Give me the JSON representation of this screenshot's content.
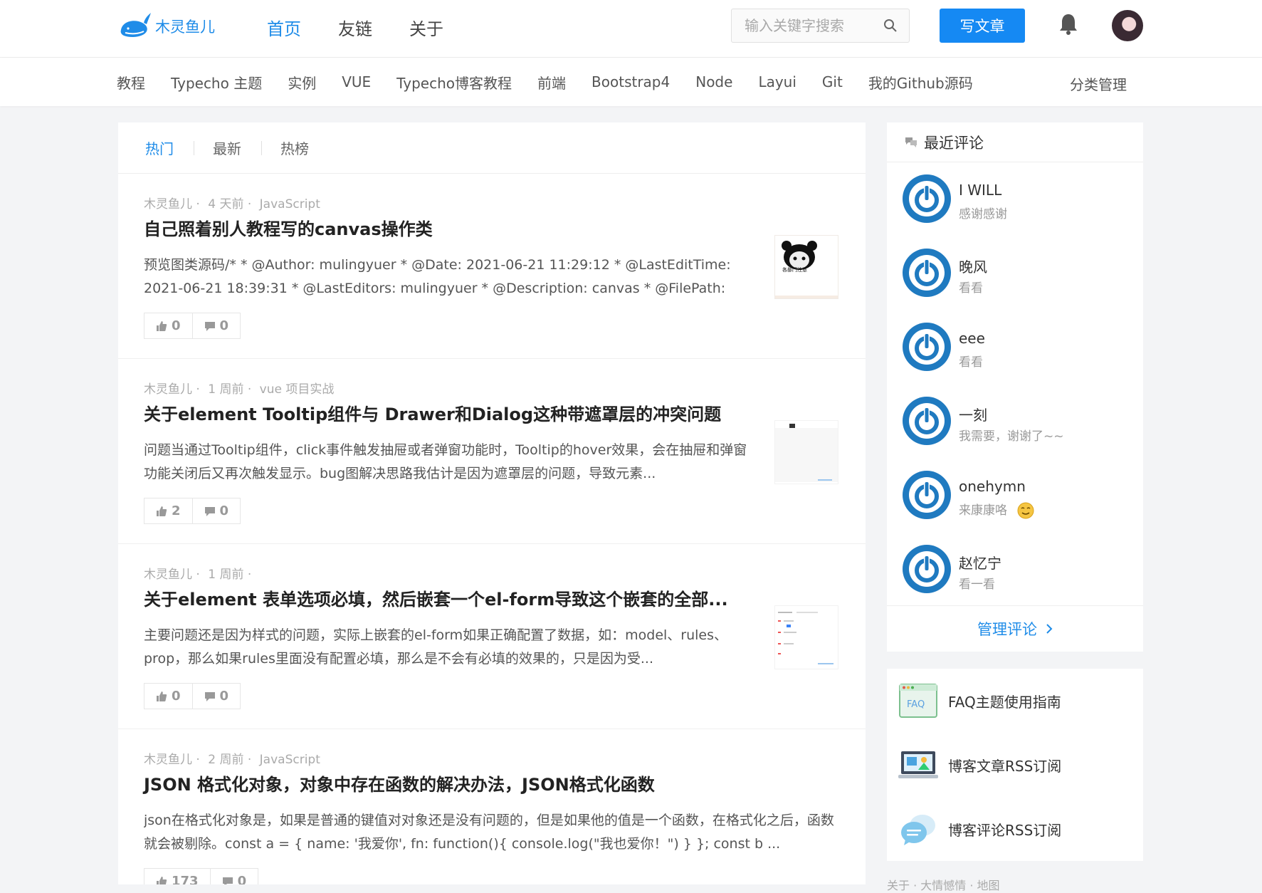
{
  "header": {
    "logo_text": "木灵鱼儿",
    "nav": [
      {
        "label": "首页",
        "active": true
      },
      {
        "label": "友链",
        "active": false
      },
      {
        "label": "关于",
        "active": false
      }
    ],
    "search_placeholder": "输入关键字搜索",
    "write_button": "写文章"
  },
  "categories": [
    "教程",
    "Typecho 主题",
    "实例",
    "VUE",
    "Typecho博客教程",
    "前端",
    "Bootstrap4",
    "Node",
    "Layui",
    "Git",
    "我的Github源码"
  ],
  "category_manage": "分类管理",
  "tabs": [
    {
      "label": "热门",
      "active": true
    },
    {
      "label": "最新",
      "active": false
    },
    {
      "label": "热榜",
      "active": false
    }
  ],
  "posts": [
    {
      "author": "木灵鱼儿 ·",
      "time": "4 天前 ·",
      "category": "JavaScript",
      "title": "自己照着别人教程写的canvas操作类",
      "excerpt": "预览图类源码/* * @Author: mulingyuer * @Date: 2021-06-21 11:29:12 * @LastEditTime: 2021-06-21 18:39:31 * @LastEditors: mulingyuer * @Description: canvas * @FilePath: \\for...",
      "likes": "0",
      "comments": "0",
      "thumb_text": "各部门注意"
    },
    {
      "author": "木灵鱼儿 ·",
      "time": "1 周前 ·",
      "category": "vue 项目实战",
      "title": "关于element Tooltip组件与 Drawer和Dialog这种带遮罩层的冲突问题",
      "excerpt": "问题当通过Tooltip组件，click事件触发抽屉或者弹窗功能时，Tooltip的hover效果，会在抽屉和弹窗功能关闭后又再次触发显示。bug图解决思路我估计是因为遮罩层的问题，导致元素...",
      "likes": "2",
      "comments": "0",
      "thumb_text": ""
    },
    {
      "author": "木灵鱼儿 ·",
      "time": "1 周前 ·",
      "category": "",
      "title": "关于element 表单选项必填，然后嵌套一个el-form导致这个嵌套的全部...",
      "excerpt": "主要问题还是因为样式的问题，实际上嵌套的el-form如果正确配置了数据，如：model、rules、prop，那么如果rules里面没有配置必填，那么是不会有必填的效果的，只是因为受...",
      "likes": "0",
      "comments": "0",
      "thumb_text": ""
    },
    {
      "author": "木灵鱼儿 ·",
      "time": "2 周前 ·",
      "category": "JavaScript",
      "title": "JSON 格式化对象，对象中存在函数的解决办法，JSON格式化函数",
      "excerpt": "json在格式化对象是，如果是普通的键值对对象还是没有问题的，但是如果他的值是一个函数，在格式化之后，函数就会被剔除。const a = { name: '我爱你', fn: function(){ console.log(\"我也爱你！\") } }; const b ...",
      "likes": "173",
      "comments": "0",
      "thumb_text": ""
    }
  ],
  "sidebar": {
    "recent_title": "最近评论",
    "comments": [
      {
        "name": "I WILL",
        "text": "感谢感谢"
      },
      {
        "name": "晚风",
        "text": "看看"
      },
      {
        "name": "eee",
        "text": "看看"
      },
      {
        "name": "一刻",
        "text": "我需要，谢谢了~~"
      },
      {
        "name": "onehymn",
        "text": "来康康咯"
      },
      {
        "name": "赵忆宁",
        "text": "看一看"
      }
    ],
    "manage_comments": "管理评论",
    "links": [
      {
        "label": "FAQ主题使用指南",
        "icon": "faq-icon",
        "icon_text": "FAQ"
      },
      {
        "label": "博客文章RSS订阅",
        "icon": "monitor-icon"
      },
      {
        "label": "博客评论RSS订阅",
        "icon": "chat-bubble-icon"
      }
    ],
    "footer_links": "关于 · 大情憾情 · 地图"
  },
  "colors": {
    "accent": "#1f8ce8",
    "button": "#1589f3",
    "avatar": "#1f7ac0"
  }
}
